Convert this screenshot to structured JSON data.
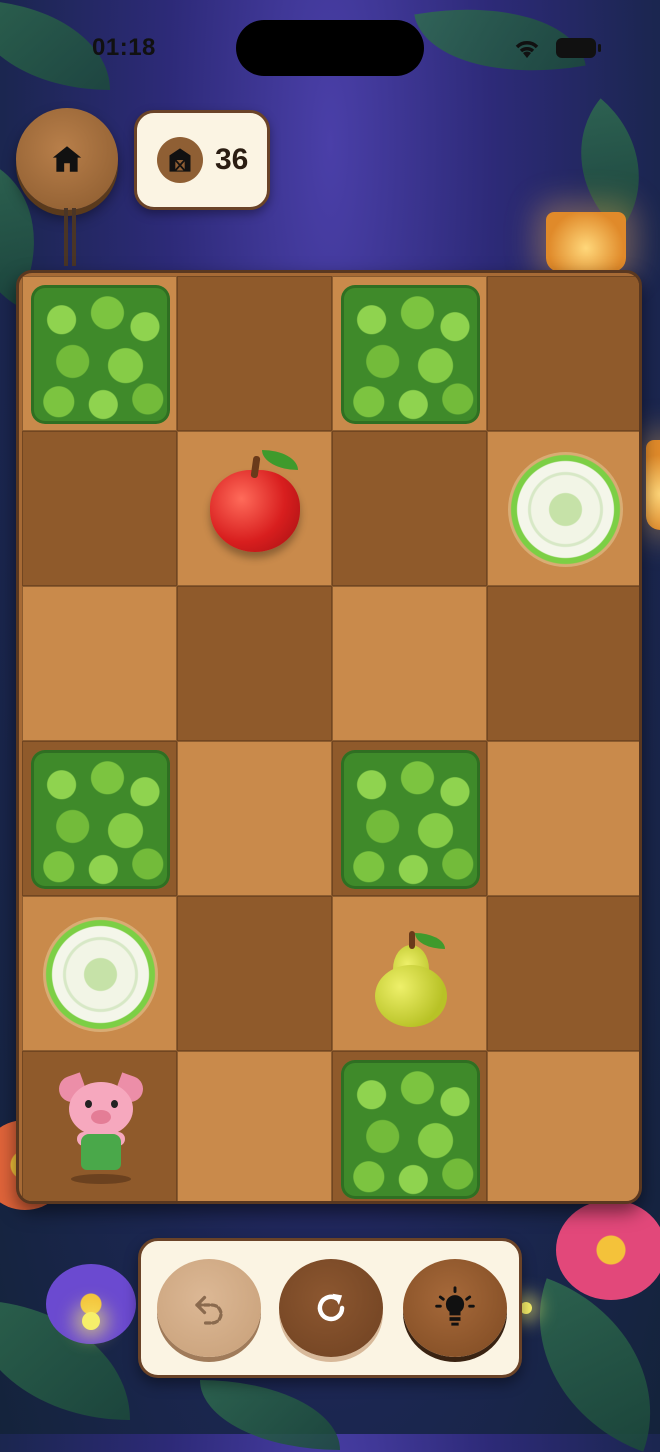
{
  "status_bar": {
    "time": "01:18"
  },
  "header": {
    "score": "36",
    "home_icon": "home-icon",
    "score_icon": "barn-icon"
  },
  "board": {
    "rows": 6,
    "cols": 4,
    "cells": [
      [
        "bush",
        "",
        "bush",
        ""
      ],
      [
        "",
        "apple",
        "",
        "target"
      ],
      [
        "",
        "",
        "",
        ""
      ],
      [
        "bush",
        "",
        "bush",
        ""
      ],
      [
        "target",
        "",
        "pear",
        ""
      ],
      [
        "pig",
        "",
        "bush",
        ""
      ]
    ]
  },
  "controls": {
    "undo_icon": "undo-icon",
    "restart_icon": "restart-icon",
    "hint_icon": "lightbulb-icon"
  },
  "colors": {
    "board_light": "#c98a4b",
    "board_dark": "#8f5a2b",
    "button_brown": "#8a5a2e",
    "panel_cream": "#fbf4e3"
  }
}
